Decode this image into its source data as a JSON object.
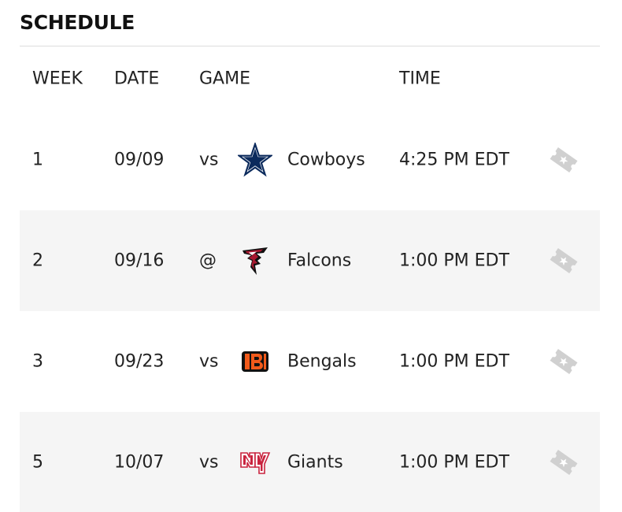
{
  "section": {
    "title": "SCHEDULE"
  },
  "columns": {
    "week": "WEEK",
    "date": "DATE",
    "game": "GAME",
    "time": "TIME"
  },
  "games": [
    {
      "week": "1",
      "date": "09/09",
      "home_away": "vs",
      "opponent": "Cowboys",
      "logo_icon": "cowboys-star-logo",
      "time": "4:25 PM EDT",
      "ticket_icon": "ticket-icon"
    },
    {
      "week": "2",
      "date": "09/16",
      "home_away": "@",
      "opponent": "Falcons",
      "logo_icon": "falcons-logo",
      "time": "1:00 PM EDT",
      "ticket_icon": "ticket-icon"
    },
    {
      "week": "3",
      "date": "09/23",
      "home_away": "vs",
      "opponent": "Bengals",
      "logo_icon": "bengals-logo",
      "time": "1:00 PM EDT",
      "ticket_icon": "ticket-icon"
    },
    {
      "week": "5",
      "date": "10/07",
      "home_away": "vs",
      "opponent": "Giants",
      "logo_icon": "giants-ny-logo",
      "time": "1:00 PM EDT",
      "ticket_icon": "ticket-icon"
    }
  ],
  "colors": {
    "row_shade": "#f5f5f5",
    "divider": "#dddddd",
    "ticket_icon": "#d0d0d0",
    "cowboys_navy": "#0b2a5c",
    "bengals_orange": "#f25a1b",
    "giants_red": "#c9243f",
    "falcons_red": "#a71930"
  }
}
